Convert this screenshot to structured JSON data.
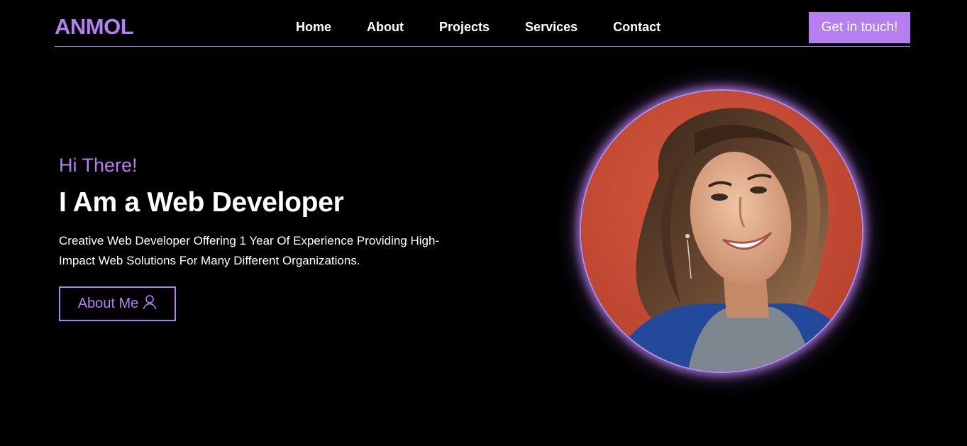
{
  "header": {
    "logo": "ANMOL",
    "nav": [
      "Home",
      "About",
      "Projects",
      "Services",
      "Contact"
    ],
    "cta_label": "Get in touch!"
  },
  "hero": {
    "greeting": "Hi There!",
    "headline": "I Am a Web Developer",
    "description": "Creative Web Developer Offering 1 Year Of Experience Providing High-Impact Web Solutions For Many Different Organizations.",
    "about_button_label": "About Me",
    "about_button_icon": "user-icon"
  },
  "portrait": {
    "icon": "profile-photo"
  },
  "colors": {
    "accent": "#b57ff0",
    "background": "#000000",
    "text": "#ffffff"
  }
}
